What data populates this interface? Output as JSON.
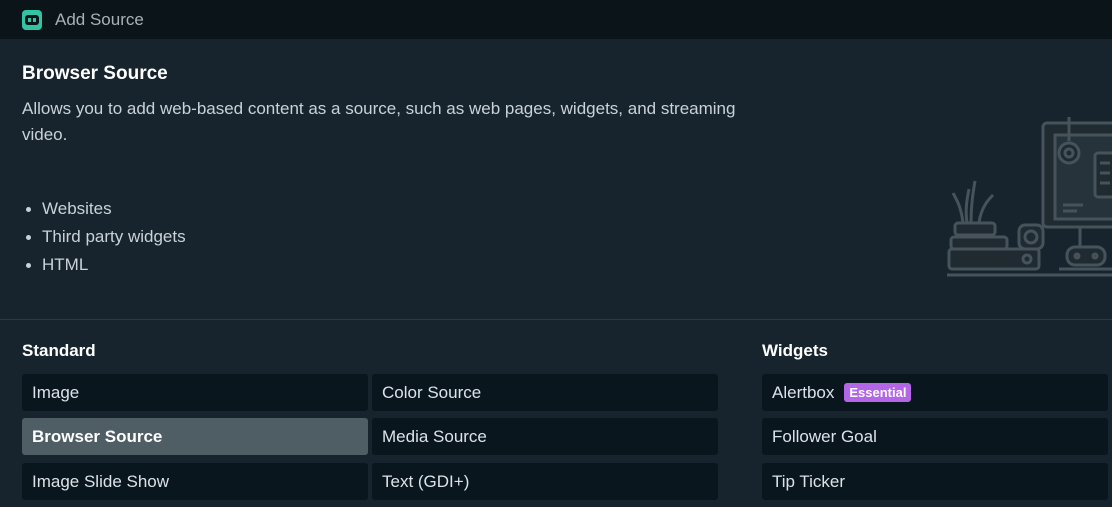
{
  "window": {
    "title": "Add Source"
  },
  "info": {
    "title": "Browser Source",
    "description": "Allows you to add web-based content as a source, such as web pages, widgets, and streaming video.",
    "features": [
      "Websites",
      "Third party widgets",
      "HTML"
    ]
  },
  "standard": {
    "label": "Standard",
    "items": [
      {
        "label": "Image",
        "selected": false
      },
      {
        "label": "Color Source",
        "selected": false
      },
      {
        "label": "Browser Source",
        "selected": true
      },
      {
        "label": "Media Source",
        "selected": false
      },
      {
        "label": "Image Slide Show",
        "selected": false
      },
      {
        "label": "Text (GDI+)",
        "selected": false
      }
    ]
  },
  "widgets": {
    "label": "Widgets",
    "items": [
      {
        "label": "Alertbox",
        "badge": "Essential"
      },
      {
        "label": "Follower Goal"
      },
      {
        "label": "Tip Ticker"
      }
    ]
  },
  "colors": {
    "accent": "#31c3a2",
    "badge": "#b367e6",
    "selected_tile": "#4f5e65",
    "tile": "#09161d",
    "background": "#17242d"
  },
  "icons": {
    "app": "streamlabs-app-icon",
    "illustration": "desk-monitor-illustration"
  }
}
